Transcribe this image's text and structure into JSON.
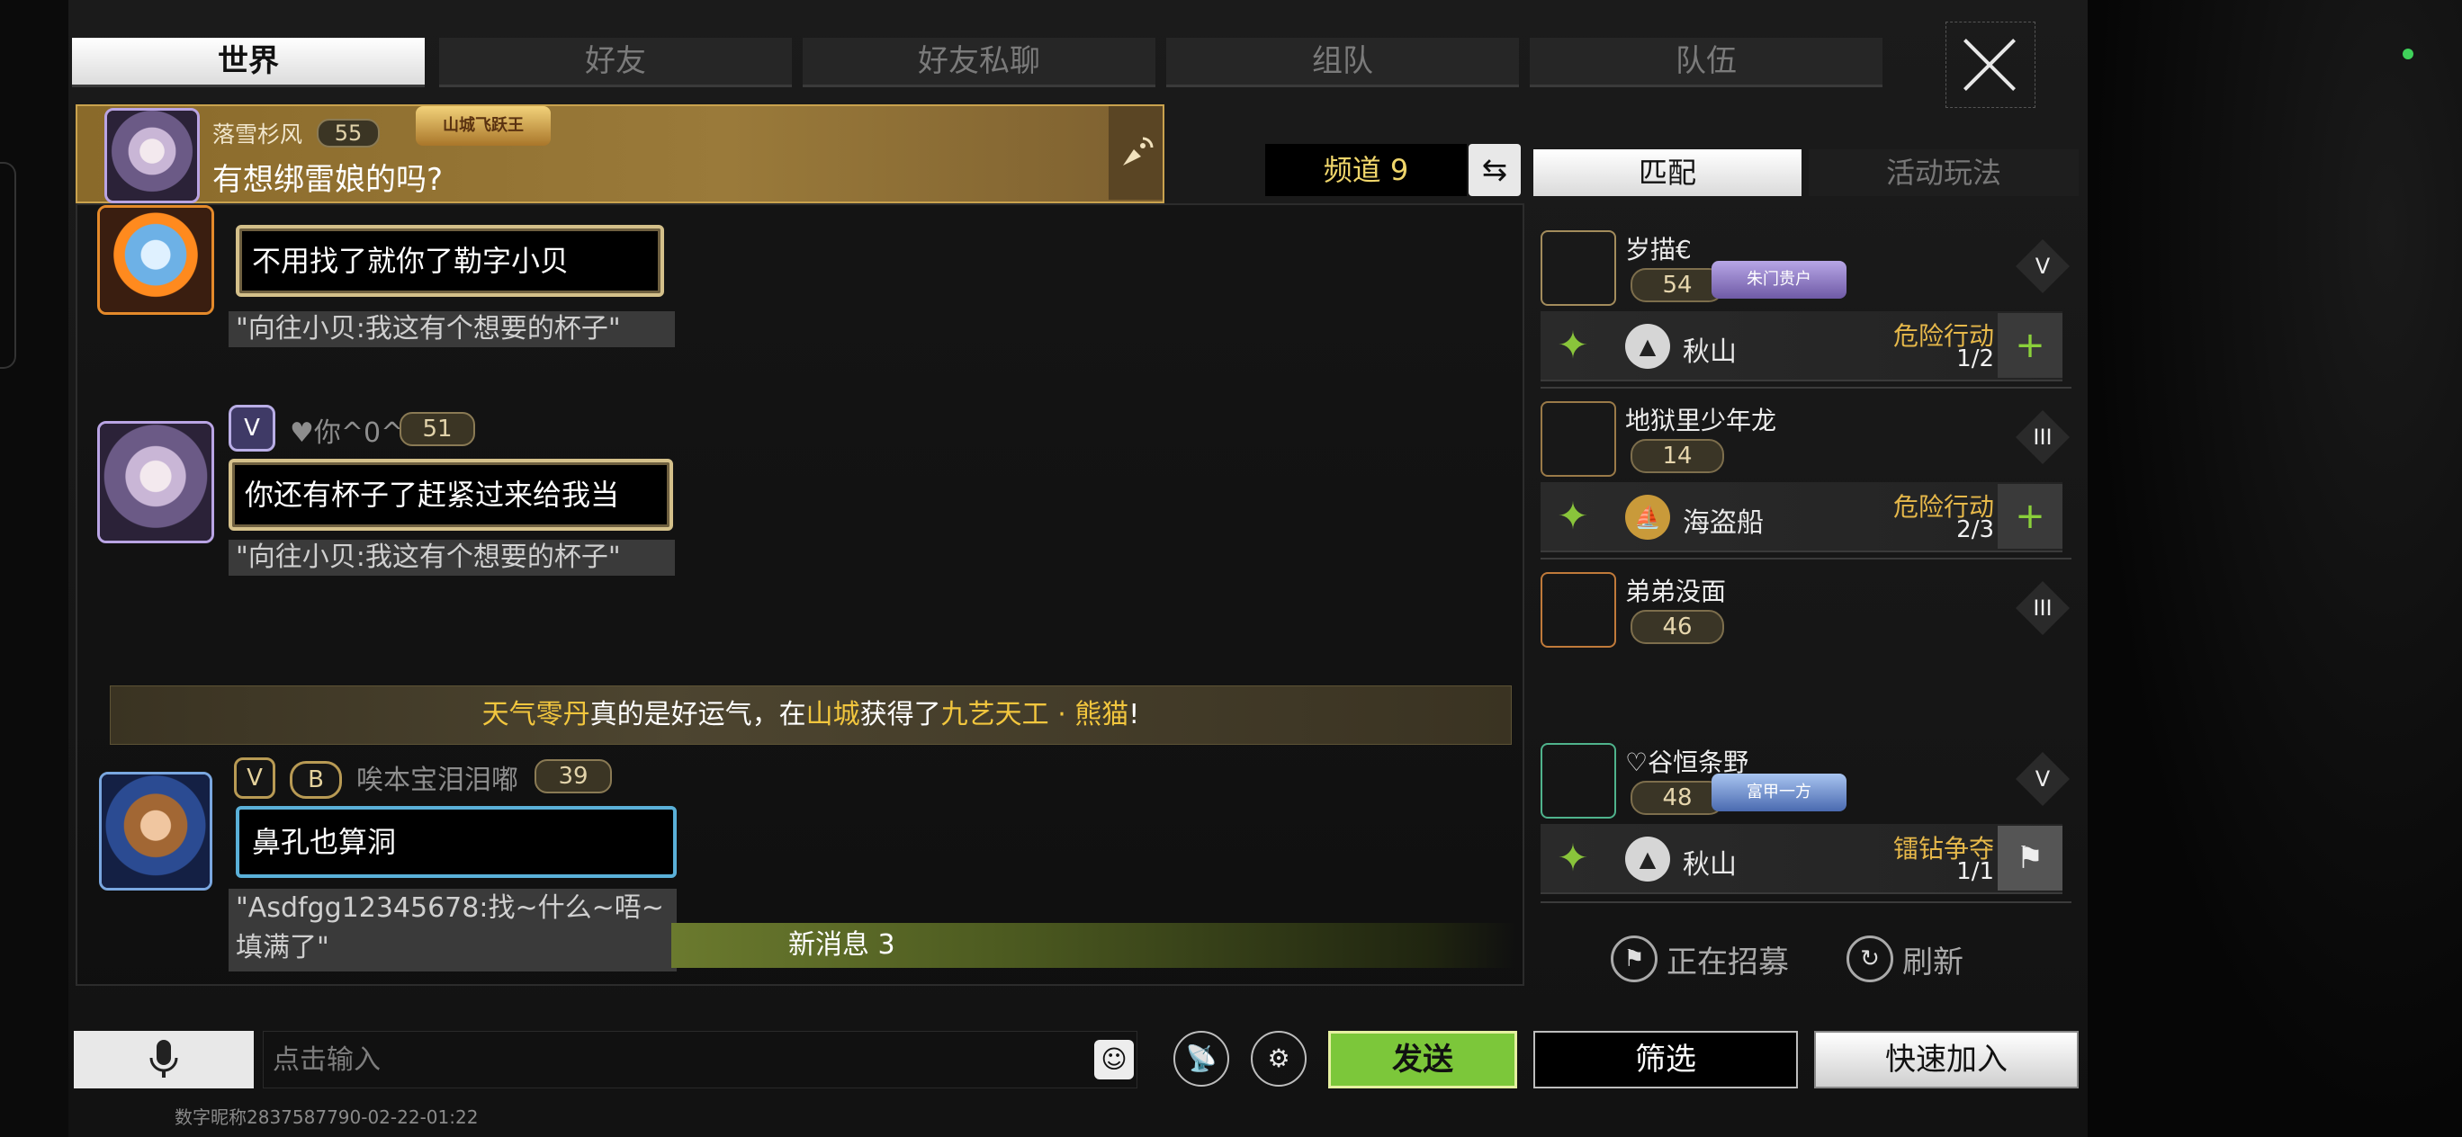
{
  "tabs": [
    "世界",
    "好友",
    "好友私聊",
    "组队",
    "队伍"
  ],
  "pinned": {
    "name": "落雪杉风",
    "level": "55",
    "badge": "山城飞跃王",
    "message": "有想绑雷娘的吗?"
  },
  "channel": {
    "label": "频道 9"
  },
  "chat": {
    "msg1": {
      "text": "不用找了就你了勒字小贝",
      "quote": "\"向往小贝:我这有个想要的杯子\""
    },
    "msg2": {
      "name": "♥你^0^",
      "level": "51",
      "vip": "V",
      "text": "你还有杯子了赶紧过来给我当",
      "quote": "\"向往小贝:我这有个想要的杯子\""
    },
    "system": {
      "p1": "天气零丹",
      "p2": "真的是好运气，在",
      "p3": "山城",
      "p4": "获得了",
      "p5": "九艺天工 · 熊猫",
      "p6": "!"
    },
    "msg3": {
      "name": "唉本宝泪泪嘟",
      "level": "39",
      "vip": "V",
      "badge": "B",
      "text": "鼻孔也算洞",
      "quote": "\"Asdfgg12345678:找~什么~唔~填满了\""
    },
    "new_messages": "新消息 3"
  },
  "input": {
    "placeholder": "点击输入",
    "send": "发送"
  },
  "footer": "数字昵称2837587790-02-22-01:22",
  "right": {
    "tabs": [
      "匹配",
      "活动玩法"
    ],
    "teams": [
      {
        "name": "岁描€",
        "level": "54",
        "badge": "朱门贵户",
        "rank": "V",
        "map": "秋山",
        "activity": "危险行动",
        "count": "1/2",
        "join": "+"
      },
      {
        "name": "地狱里少年龙",
        "level": "14",
        "rank": "III",
        "map": "海盗船",
        "activity": "危险行动",
        "count": "2/3",
        "join": "+"
      },
      {
        "name": "弟弟没面",
        "level": "46",
        "rank": "III"
      },
      {
        "name": "♡谷恒条野",
        "level": "48",
        "badge": "富甲一方",
        "rank": "V",
        "map": "秋山",
        "activity": "镭钻争夺",
        "count": "1/1",
        "join": "⚑"
      }
    ],
    "recruiting": "正在招募",
    "refresh": "刷新",
    "filter": "筛选",
    "quick_join": "快速加入"
  },
  "colors": {
    "accent_green": "#7cc73a",
    "gold": "#f2c63e",
    "activity": "#e6b84a"
  },
  "icons": [
    "mic-icon",
    "broadcast-icon",
    "swap-icon",
    "emoji-icon",
    "close-icon",
    "flag-icon",
    "refresh-icon",
    "person-icon"
  ]
}
